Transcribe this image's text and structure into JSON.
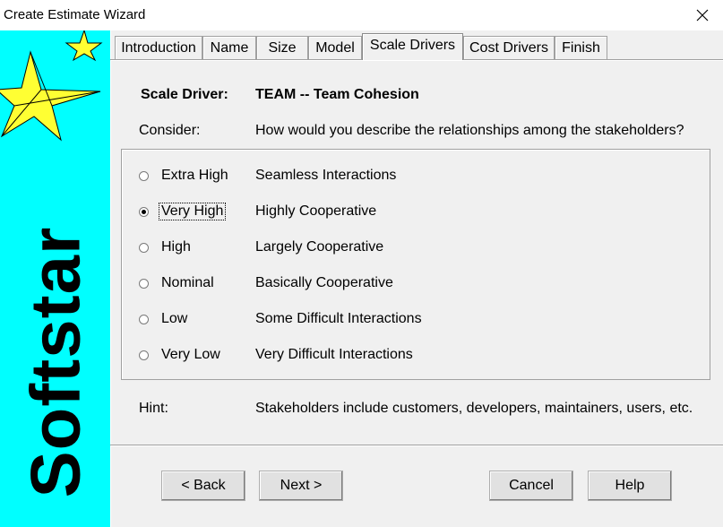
{
  "window": {
    "title": "Create Estimate Wizard"
  },
  "sidebar": {
    "brand": "Softstar"
  },
  "tabs": [
    {
      "label": "Introduction",
      "active": false
    },
    {
      "label": "Name",
      "active": false
    },
    {
      "label": "Size",
      "active": false
    },
    {
      "label": "Model",
      "active": false
    },
    {
      "label": "Scale Drivers",
      "active": true
    },
    {
      "label": "Cost Drivers",
      "active": false
    },
    {
      "label": "Finish",
      "active": false
    }
  ],
  "content": {
    "scale_driver_label": "Scale Driver:",
    "scale_driver_value": "TEAM -- Team Cohesion",
    "consider_label": "Consider:",
    "consider_text": "How would you describe the relationships among the stakeholders?",
    "options": [
      {
        "rating": "Extra High",
        "description": "Seamless Interactions",
        "selected": false
      },
      {
        "rating": "Very High",
        "description": "Highly Cooperative",
        "selected": true
      },
      {
        "rating": "High",
        "description": "Largely Cooperative",
        "selected": false
      },
      {
        "rating": "Nominal",
        "description": "Basically Cooperative",
        "selected": false
      },
      {
        "rating": "Low",
        "description": "Some Difficult Interactions",
        "selected": false
      },
      {
        "rating": "Very Low",
        "description": "Very Difficult Interactions",
        "selected": false
      }
    ],
    "hint_label": "Hint:",
    "hint_text": "Stakeholders include customers, developers, maintainers, users, etc."
  },
  "buttons": {
    "back": "< Back",
    "next": "Next >",
    "cancel": "Cancel",
    "help": "Help"
  },
  "colors": {
    "sidebar_bg": "#00ffff",
    "star_fill": "#ffff33",
    "dialog_bg": "#f0f0f0"
  }
}
